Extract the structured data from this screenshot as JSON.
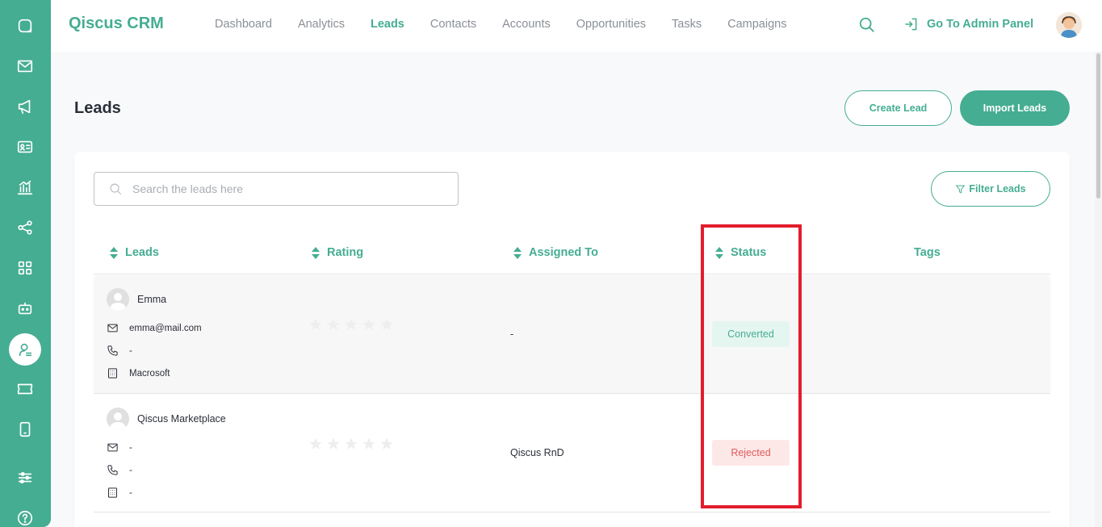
{
  "app": {
    "brand": "Qiscus CRM"
  },
  "nav": {
    "items": [
      {
        "label": "Dashboard",
        "active": false
      },
      {
        "label": "Analytics",
        "active": false
      },
      {
        "label": "Leads",
        "active": true
      },
      {
        "label": "Contacts",
        "active": false
      },
      {
        "label": "Accounts",
        "active": false
      },
      {
        "label": "Opportunities",
        "active": false
      },
      {
        "label": "Tasks",
        "active": false
      },
      {
        "label": "Campaigns",
        "active": false
      }
    ],
    "admin_label": "Go To Admin Panel"
  },
  "sidebar": {
    "icons": [
      "chat-icon",
      "mail-icon",
      "megaphone-icon",
      "contact-card-icon",
      "analytics-icon",
      "share-icon",
      "apps-grid-icon",
      "bot-icon",
      "crm-user-icon",
      "ticket-icon",
      "mobile-icon",
      "settings-sliders-icon",
      "help-icon"
    ],
    "active": "crm-user-icon"
  },
  "page": {
    "title": "Leads",
    "create_button": "Create Lead",
    "import_button": "Import Leads"
  },
  "search": {
    "placeholder": "Search the leads here"
  },
  "filter": {
    "label": "Filter Leads"
  },
  "table": {
    "headers": {
      "leads": "Leads",
      "rating": "Rating",
      "assigned": "Assigned To",
      "status": "Status",
      "tags": "Tags"
    },
    "rows": [
      {
        "name": "Emma",
        "email": "emma@mail.com",
        "phone": "-",
        "company": "Macrosoft",
        "rating": 0,
        "assigned_to": "-",
        "status": "Converted",
        "tags": ""
      },
      {
        "name": "Qiscus Marketplace",
        "email": "-",
        "phone": "-",
        "company": "-",
        "rating": 0,
        "assigned_to": "Qiscus RnD",
        "status": "Rejected",
        "tags": ""
      }
    ]
  },
  "colors": {
    "accent": "#45ad92",
    "highlight": "#e21d2d",
    "rejected": "#e05a5a"
  }
}
